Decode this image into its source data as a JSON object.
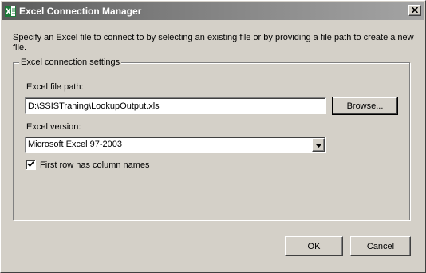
{
  "window": {
    "title": "Excel Connection Manager",
    "close_glyph": "✕"
  },
  "description": "Specify an Excel file to connect to by selecting an existing file or by providing a file path to create a new file.",
  "group": {
    "legend": "Excel connection settings",
    "file_path_label": "Excel file path:",
    "file_path_value": "D:\\SSISTraning\\LookupOutput.xls",
    "browse_label": "Browse...",
    "version_label": "Excel version:",
    "version_value": "Microsoft Excel 97-2003",
    "first_row_label": "First row has column names",
    "first_row_checked": true
  },
  "footer": {
    "ok_label": "OK",
    "cancel_label": "Cancel"
  },
  "icons": {
    "app": "excel-icon",
    "close": "close-icon",
    "dropdown": "chevron-down-icon",
    "check": "checkmark-icon"
  },
  "colors": {
    "window_bg": "#d4d0c8",
    "title_gradient_start": "#5a5a5a",
    "title_gradient_end": "#a4a4a4",
    "excel_green": "#1d7a3a"
  }
}
